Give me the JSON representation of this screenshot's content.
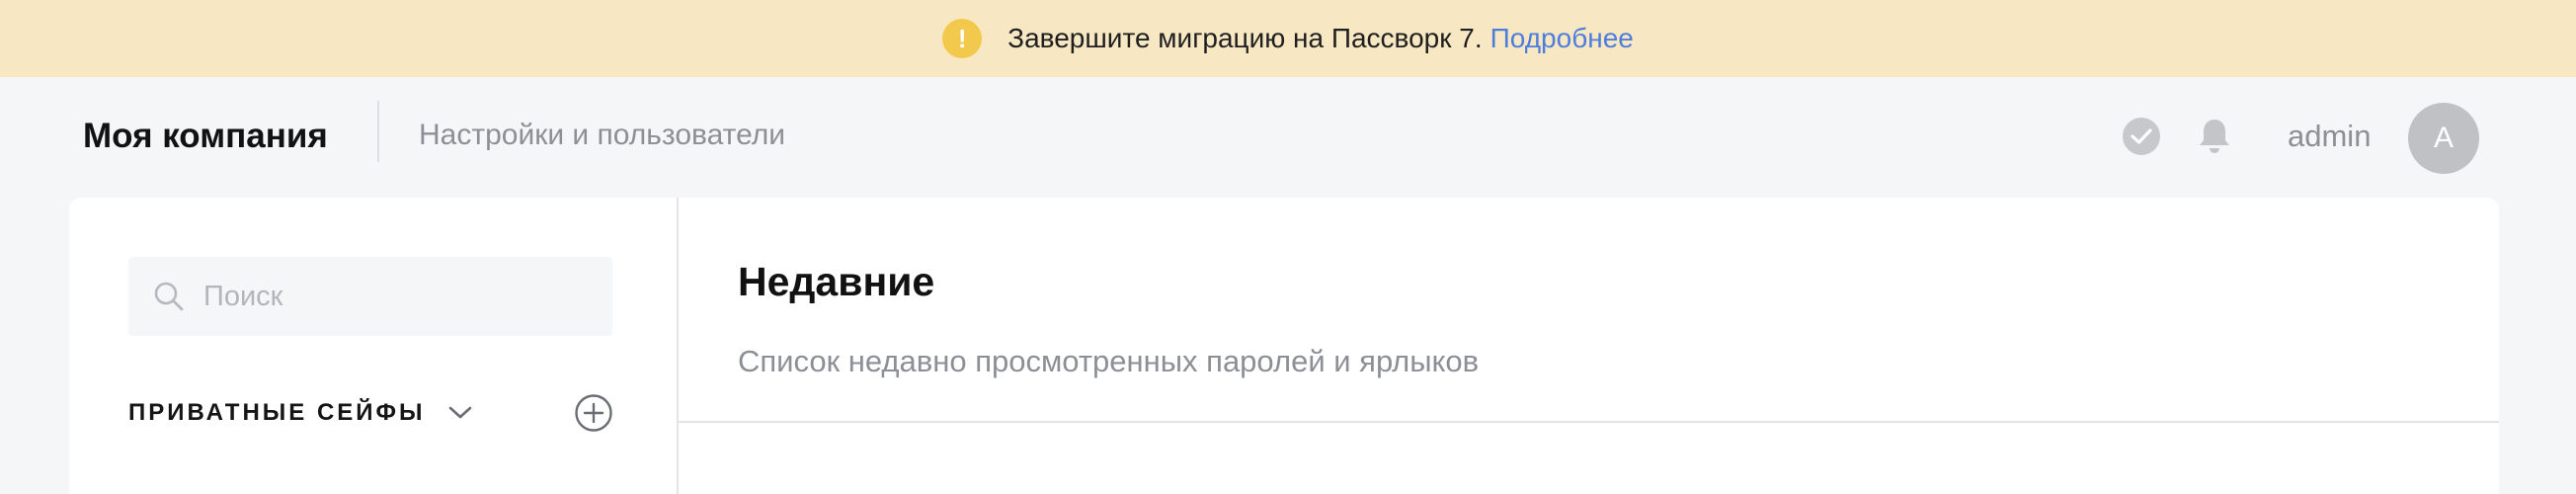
{
  "banner": {
    "icon": "exclamation-icon",
    "message": "Завершите миграцию на Пассворк 7.",
    "link": "Подробнее",
    "icon_color": "#f2c94c",
    "link_color": "#4f7ddc",
    "background": "#f7e8c3"
  },
  "header": {
    "company": "Моя компания",
    "settings_link": "Настройки и пользователи",
    "status_icon": "check-circle-icon",
    "notifications_icon": "bell-icon",
    "username": "admin",
    "avatar_letter": "A"
  },
  "sidebar": {
    "search_placeholder": "Поиск",
    "search_icon": "search-icon",
    "section_title": "ПРИВАТНЫЕ СЕЙФЫ",
    "section_toggle_icon": "chevron-down-icon",
    "add_icon": "plus-circle-icon"
  },
  "main": {
    "title": "Недавние",
    "subtitle": "Список недавно просмотренных паролей и ярлыков"
  }
}
